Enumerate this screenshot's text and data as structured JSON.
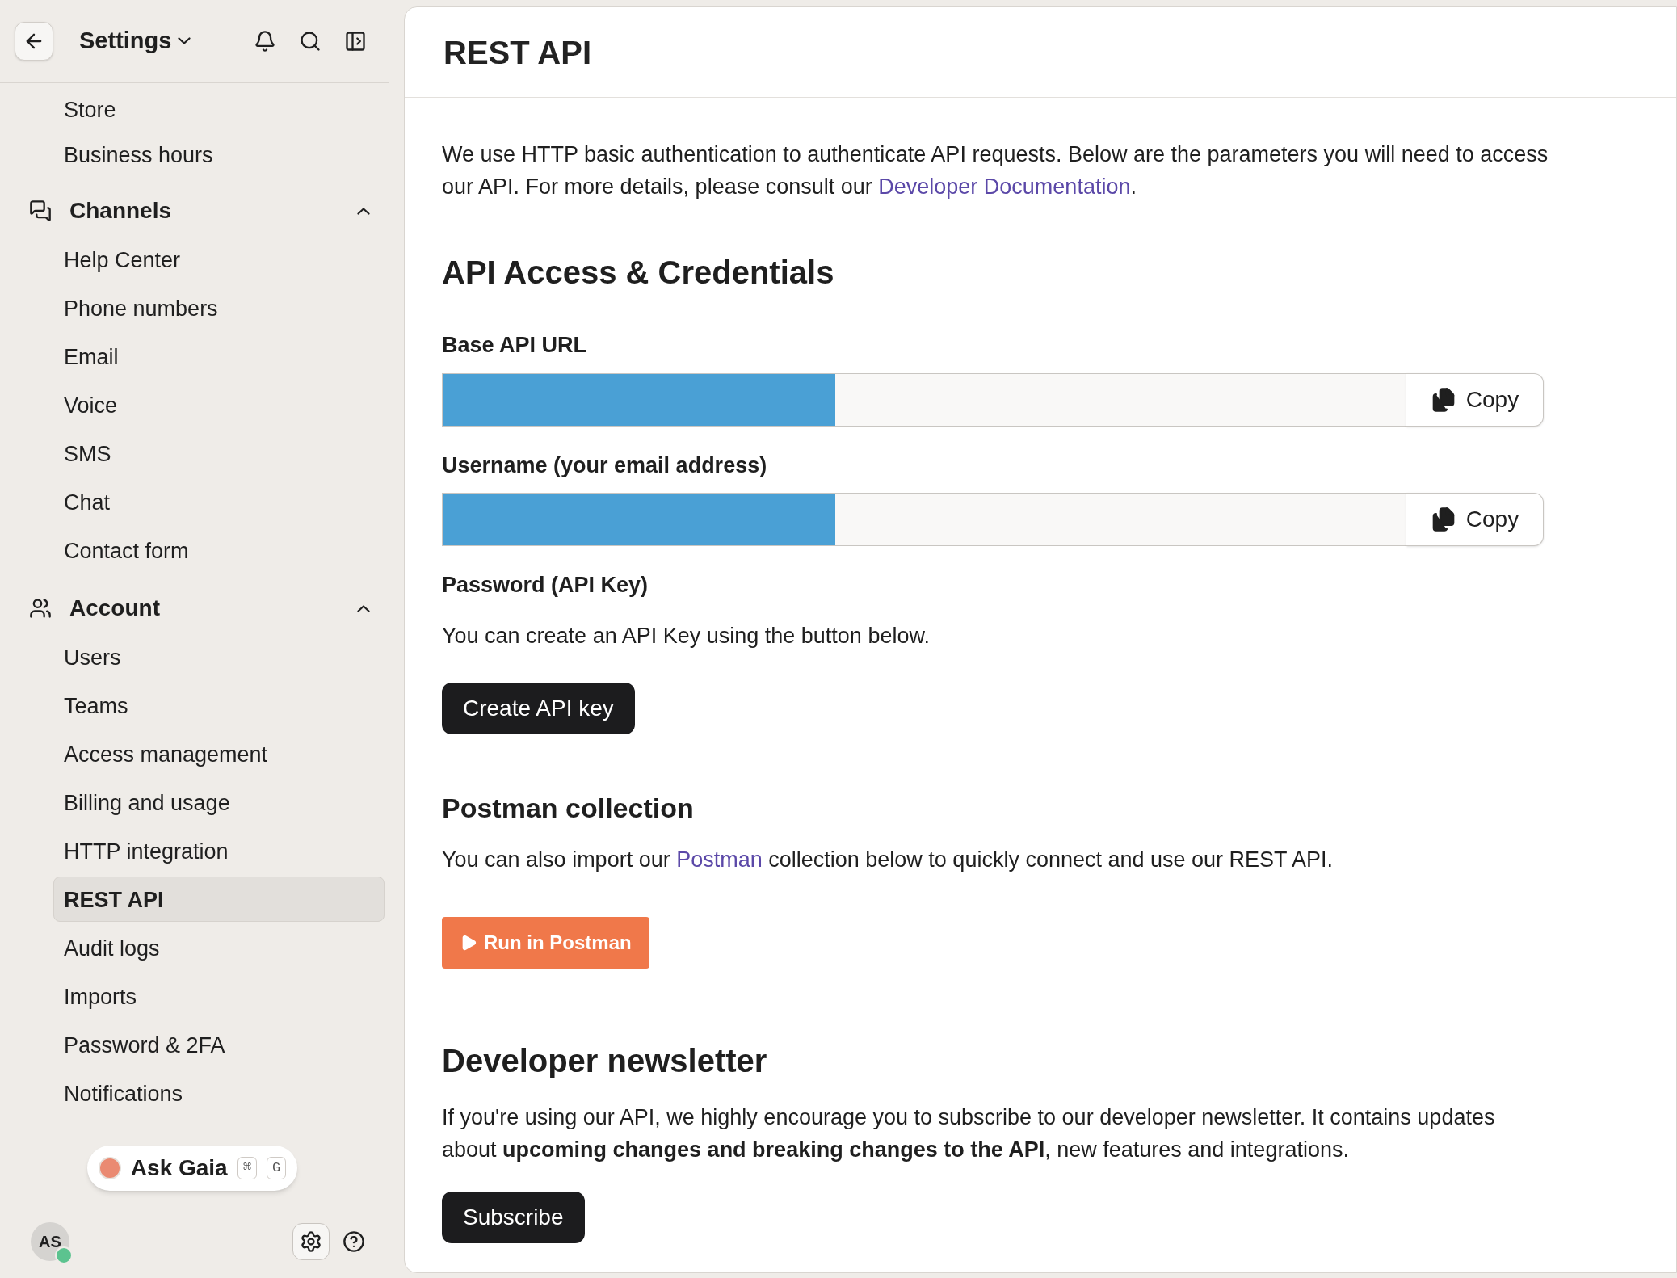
{
  "sidebar": {
    "title": "Settings",
    "nav": [
      {
        "kind": "item",
        "label": "Store",
        "selected": false
      },
      {
        "kind": "item",
        "label": "Business hours",
        "selected": false
      },
      {
        "kind": "group",
        "label": "Channels",
        "expanded": true,
        "children": [
          {
            "label": "Help Center",
            "selected": false
          },
          {
            "label": "Phone numbers",
            "selected": false
          },
          {
            "label": "Email",
            "selected": false
          },
          {
            "label": "Voice",
            "selected": false
          },
          {
            "label": "SMS",
            "selected": false
          },
          {
            "label": "Chat",
            "selected": false
          },
          {
            "label": "Contact form",
            "selected": false
          }
        ]
      },
      {
        "kind": "group",
        "label": "Account",
        "expanded": true,
        "children": [
          {
            "label": "Users",
            "selected": false
          },
          {
            "label": "Teams",
            "selected": false
          },
          {
            "label": "Access management",
            "selected": false
          },
          {
            "label": "Billing and usage",
            "selected": false
          },
          {
            "label": "HTTP integration",
            "selected": false
          },
          {
            "label": "REST API",
            "selected": true
          },
          {
            "label": "Audit logs",
            "selected": false
          },
          {
            "label": "Imports",
            "selected": false
          },
          {
            "label": "Password & 2FA",
            "selected": false
          },
          {
            "label": "Notifications",
            "selected": false
          }
        ]
      }
    ],
    "assistant": {
      "label": "Ask Gaia",
      "keys": [
        "⌘",
        "G"
      ]
    },
    "user": {
      "initials": "AS",
      "online": true
    }
  },
  "main": {
    "title": "REST API",
    "intro": {
      "before": "We use HTTP basic authentication to authenticate API requests. Below are the parameters you will need to access our API. For more details, please consult our ",
      "link": "Developer Documentation",
      "after": "."
    },
    "credentials": {
      "heading": "API Access & Credentials",
      "fields": [
        {
          "label": "Base API URL",
          "button": "Copy"
        },
        {
          "label": "Username (your email address)",
          "button": "Copy"
        }
      ],
      "password": {
        "label": "Password (API Key)",
        "text": "You can create an API Key using the button below.",
        "button": "Create API key"
      }
    },
    "postman": {
      "heading": "Postman collection",
      "before": "You can also import our ",
      "link": "Postman",
      "after": " collection below to quickly connect and use our REST API.",
      "button": "Run in Postman"
    },
    "newsletter": {
      "heading": "Developer newsletter",
      "text": "If you're using our API, we highly encourage you to subscribe to our developer newsletter. It contains updates about **upcoming changes and breaking changes to the API**, new features and integrations.",
      "button": "Subscribe"
    }
  }
}
